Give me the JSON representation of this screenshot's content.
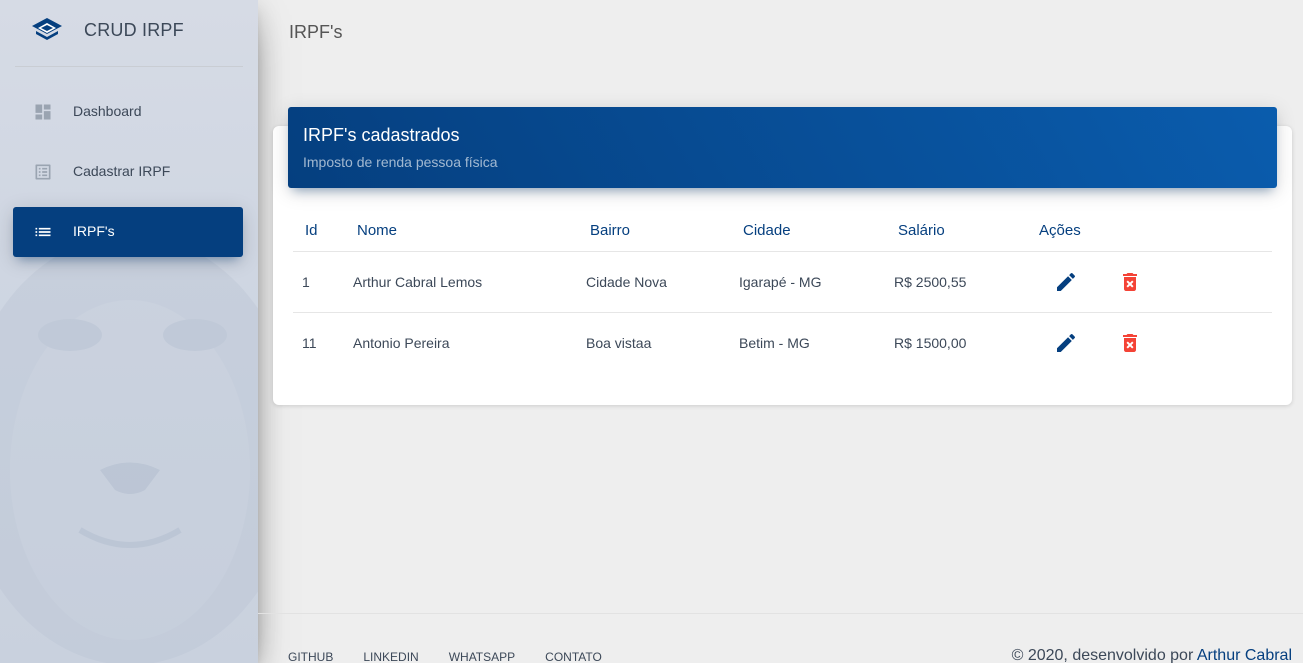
{
  "sidebar": {
    "brand": "CRUD IRPF",
    "items": [
      {
        "label": "Dashboard",
        "icon": "dashboard-icon"
      },
      {
        "label": "Cadastrar IRPF",
        "icon": "list-alt-icon"
      },
      {
        "label": "IRPF's",
        "icon": "list-icon",
        "active": true
      }
    ]
  },
  "header": {
    "title": "IRPF's"
  },
  "card": {
    "title": "IRPF's cadastrados",
    "subtitle": "Imposto de renda pessoa física"
  },
  "table": {
    "columns": [
      "Id",
      "Nome",
      "Bairro",
      "Cidade",
      "Salário",
      "Ações"
    ],
    "rows": [
      {
        "id": "1",
        "nome": "Arthur Cabral Lemos",
        "bairro": "Cidade Nova",
        "cidade": "Igarapé - MG",
        "salario": "R$ 2500,55"
      },
      {
        "id": "11",
        "nome": "Antonio Pereira",
        "bairro": "Boa vistaa",
        "cidade": "Betim - MG",
        "salario": "R$ 1500,00"
      }
    ]
  },
  "footer": {
    "links": [
      "GITHUB",
      "LINKEDIN",
      "WHATSAPP",
      "CONTATO"
    ],
    "copyright_prefix": "© 2020, desenvolvido por ",
    "copyright_author": "Arthur Cabral"
  },
  "colors": {
    "primary": "#053f7f",
    "delete": "#f44336",
    "sidebar_bg": "#d6dbe5",
    "page_bg": "#eeeeee"
  }
}
